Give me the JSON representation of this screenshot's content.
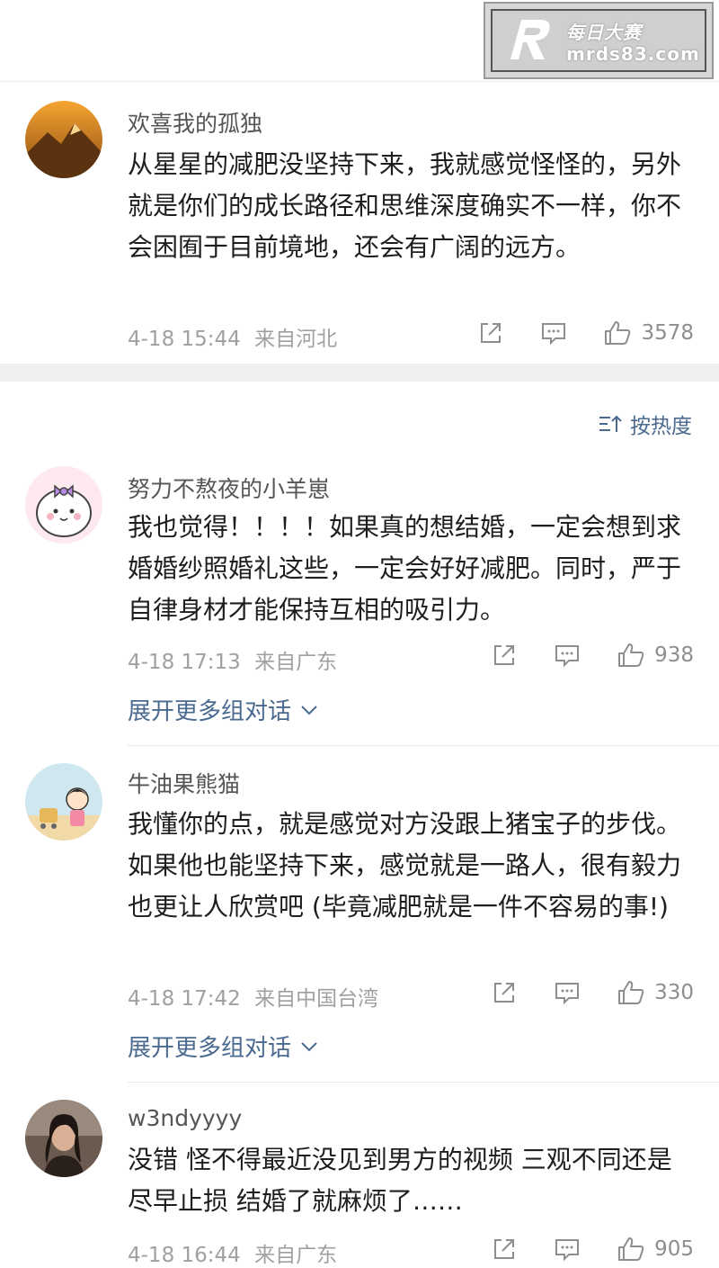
{
  "watermark": {
    "brand_cn": "每日大赛",
    "url": "mrds83.com"
  },
  "sort": {
    "label": "按热度"
  },
  "comments": [
    {
      "username": "欢喜我的孤独",
      "text": "从星星的减肥没坚持下来，我就感觉怪怪的，另外就是你们的成长路径和思维深度确实不一样，你不会困囿于目前境地，还会有广阔的远方。",
      "time": "4-18 15:44",
      "location": "来自河北",
      "likes": "3578"
    },
    {
      "username": "努力不熬夜的小羊崽",
      "text": "我也觉得！！！！如果真的想结婚，一定会想到求婚婚纱照婚礼这些，一定会好好减肥。同时，严于自律身材才能保持互相的吸引力。",
      "time": "4-18 17:13",
      "location": "来自广东",
      "likes": "938",
      "expand_label": "展开更多组对话"
    },
    {
      "username": "牛油果熊猫",
      "text": "我懂你的点，就是感觉对方没跟上猪宝子的步伐。如果他也能坚持下来，感觉就是一路人，很有毅力也更让人欣赏吧 (毕竟减肥就是一件不容易的事!)",
      "time": "4-18 17:42",
      "location": "来自中国台湾",
      "likes": "330",
      "expand_label": "展开更多组对话"
    },
    {
      "username": "w3ndyyyy",
      "text": "没错 怪不得最近没见到男方的视频 三观不同还是尽早止损 结婚了就麻烦了……",
      "time": "4-18 16:44",
      "location": "来自广东",
      "likes": "905"
    }
  ]
}
